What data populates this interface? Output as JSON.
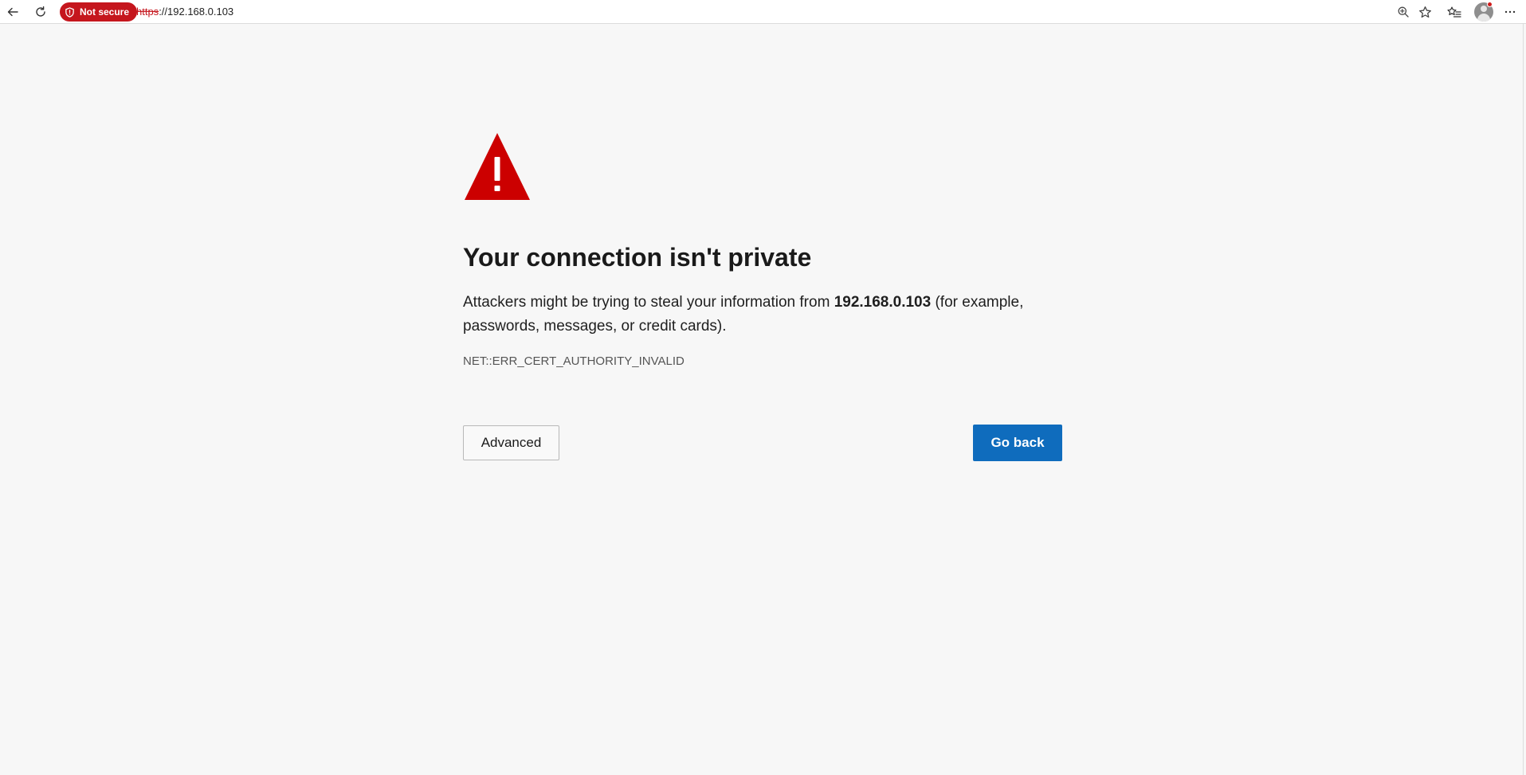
{
  "toolbar": {
    "back_icon": "back-arrow-icon",
    "reload_icon": "reload-icon",
    "security_chip": {
      "label": "Not secure",
      "icon": "shield-warning-icon",
      "color": "#c5161d"
    },
    "url": {
      "scheme": "https",
      "rest": "://192.168.0.103"
    },
    "zoom_icon": "zoom-in-icon",
    "favorite_icon": "star-icon",
    "favorites_list_icon": "favorites-list-icon",
    "profile_icon": "profile-avatar-icon",
    "menu_icon": "more-options-icon"
  },
  "page": {
    "icon": "warning-triangle-icon",
    "title": "Your connection isn't private",
    "description": {
      "before": "Attackers might be trying to steal your information from ",
      "host": "192.168.0.103",
      "after": " (for example, passwords, messages, or credit cards)."
    },
    "error_code": "NET::ERR_CERT_AUTHORITY_INVALID",
    "advanced_label": "Advanced",
    "go_back_label": "Go back"
  },
  "colors": {
    "danger": "#c5161d",
    "warning_icon": "#cc0000",
    "primary_button": "#0f6cbd",
    "page_background": "#f7f7f7"
  }
}
